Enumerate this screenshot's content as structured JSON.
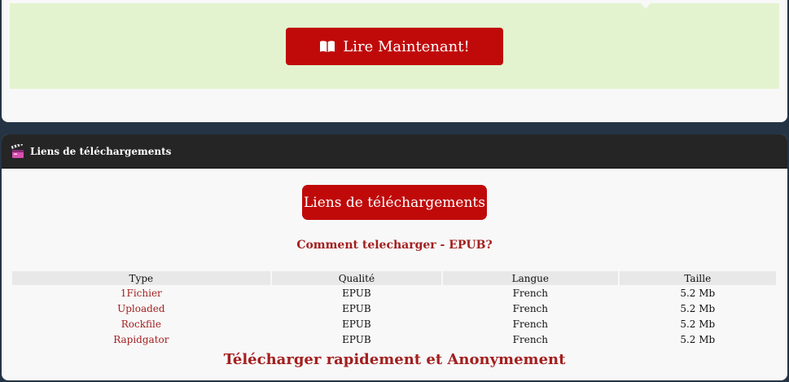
{
  "read_section": {
    "button_label": "Lire Maintenant!",
    "icon": "book-icon"
  },
  "downloads": {
    "header_title": "Liens de téléchargements",
    "header_icon": "clapperboard-icon",
    "button_label": "Liens de téléchargements",
    "how_to_link": "Comment telecharger - EPUB?",
    "table": {
      "columns": [
        "Type",
        "Qualité",
        "Langue",
        "Taille"
      ],
      "rows": [
        {
          "host": "1Fichier",
          "quality": "EPUB",
          "language": "French",
          "size": "5.2 Mb"
        },
        {
          "host": "Uploaded",
          "quality": "EPUB",
          "language": "French",
          "size": "5.2 Mb"
        },
        {
          "host": "Rockfile",
          "quality": "EPUB",
          "language": "French",
          "size": "5.2 Mb"
        },
        {
          "host": "Rapidgator",
          "quality": "EPUB",
          "language": "French",
          "size": "5.2 Mb"
        }
      ]
    },
    "fast_download_link": "Télécharger rapidement et Anonymement"
  },
  "colors": {
    "page_background": "#243444",
    "card_background": "#f8f8f8",
    "green_panel": "#e3f3d0",
    "accent_red": "#c00a0a",
    "link_red": "#a31f1f",
    "header_dark": "#252525"
  }
}
